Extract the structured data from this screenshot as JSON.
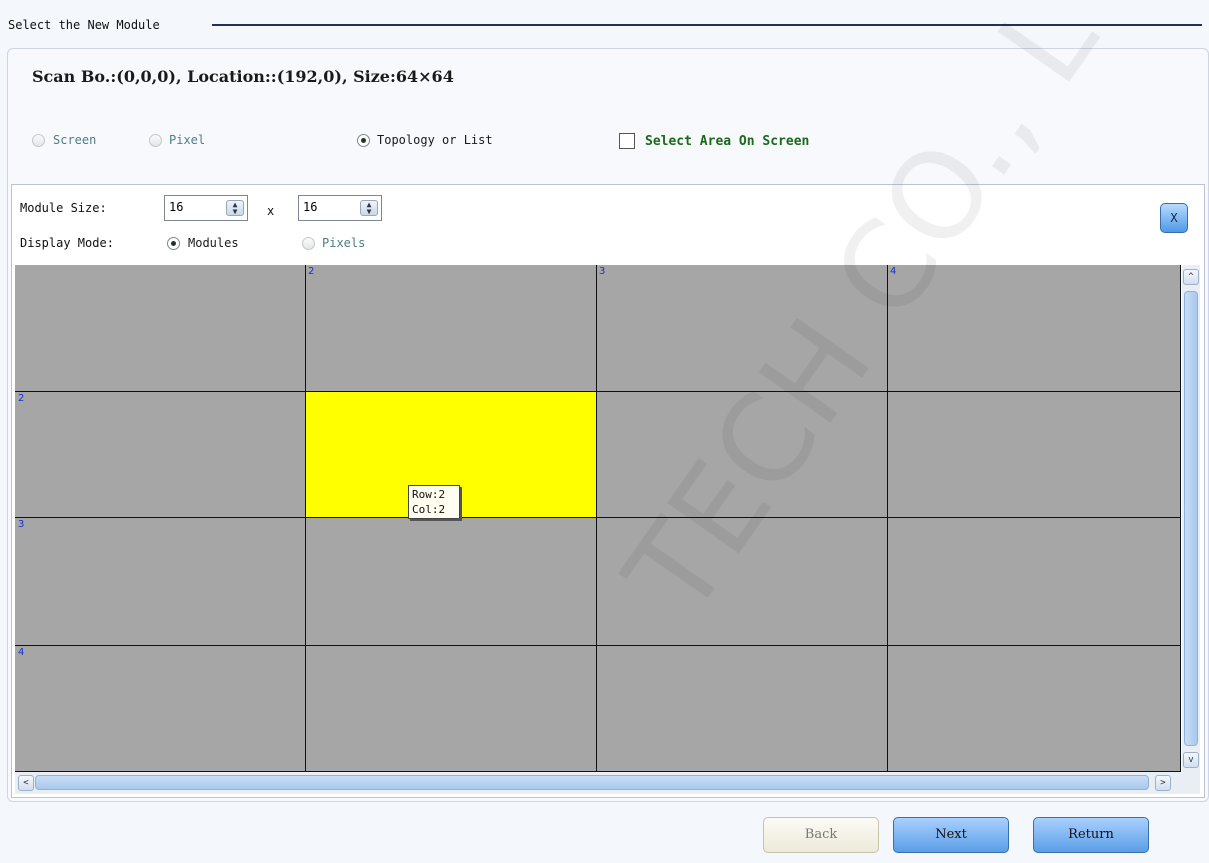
{
  "group_title": "Select the New Module",
  "info_line": "Scan Bo.:(0,0,0), Location::(192,0),  Size:64×64",
  "location_modes": [
    {
      "label": "Screen",
      "checked": false
    },
    {
      "label": "Pixel",
      "checked": false
    },
    {
      "label": "Topology or List",
      "checked": true
    }
  ],
  "select_area_label": "Select Area On Screen",
  "module_size": {
    "label": "Module Size:",
    "width": "16",
    "height": "16",
    "separator": "x"
  },
  "display_mode": {
    "label": "Display Mode:",
    "options": [
      {
        "label": "Modules",
        "checked": true
      },
      {
        "label": "Pixels",
        "checked": false
      }
    ]
  },
  "close_button_label": "X",
  "grid": {
    "col_headers": [
      "",
      "2",
      "3",
      "4"
    ],
    "row_headers": [
      "",
      "2",
      "3",
      "4"
    ],
    "selected_cell": {
      "row": 2,
      "col": 2
    },
    "cell_color": "#a6a6a6",
    "selected_color": "#ffff00",
    "line_color": "#111111",
    "number_color": "#1034d6"
  },
  "tooltip": {
    "row": "Row:2",
    "col": "Col:2"
  },
  "scroll": {
    "up": "^",
    "down": "v",
    "left": "<",
    "right": ">"
  },
  "buttons": {
    "back": "Back",
    "next": "Next",
    "return": "Return"
  },
  "watermark": "TECH CO., L"
}
